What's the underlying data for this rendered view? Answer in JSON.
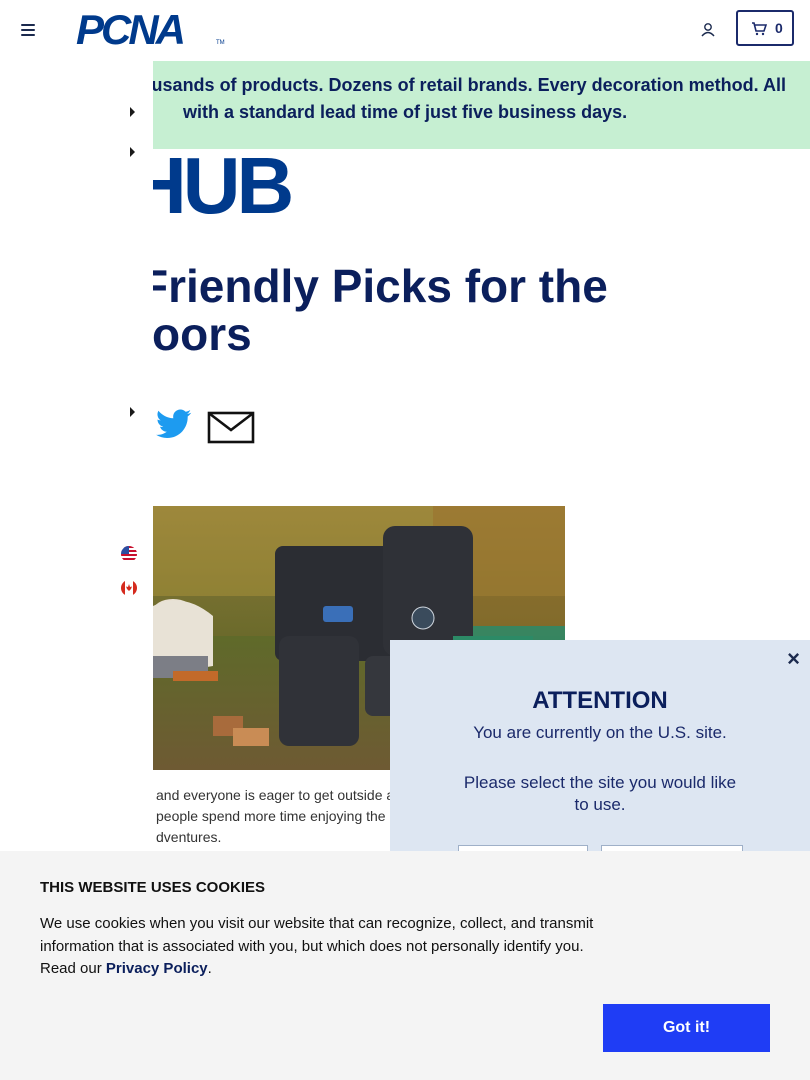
{
  "header": {
    "logo_text": "PCNA",
    "logo_tm": "TM",
    "cart_count": "0"
  },
  "banner": {
    "line1": "usands of products. Dozens of retail brands. Every decoration method. All",
    "line2": "with a standard lead time of just five business days."
  },
  "article": {
    "hub_logo": "HUB",
    "title_line1": "Friendly Picks for the",
    "title_line2": "oors",
    "body_line1": "and everyone is eager to get outside a",
    "body_line2": "people spend more time enjoying the g",
    "body_line3": "dventures."
  },
  "share": {
    "twitter_icon": "twitter-bird-icon",
    "email_icon": "envelope-icon"
  },
  "attention": {
    "close": "×",
    "title": "ATTENTION",
    "message": "You are currently on the U.S. site.",
    "prompt": "Please select the site you would like to use."
  },
  "cookie": {
    "title": "THIS WEBSITE USES COOKIES",
    "text": "We use cookies when you visit our website that can recognize, collect, and transmit information that is associated with you, but which does not personally identify you. Read our",
    "link": "Privacy Policy",
    "period": ".",
    "button": "Got it!"
  },
  "colors": {
    "brand_blue": "#003a8c",
    "navy": "#0b1f5c",
    "banner_green": "#c6efd2",
    "cookie_button": "#1f3df5",
    "twitter_blue": "#1d9bf0"
  }
}
